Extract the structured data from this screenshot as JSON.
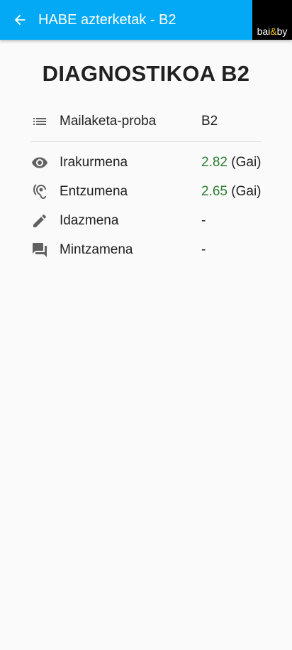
{
  "appbar": {
    "title": "HABE azterketak - B2",
    "back_icon": "arrow-back-icon",
    "logo": {
      "left": "bai",
      "amp": "&",
      "right": "by",
      "amp_color": "#f5c400"
    },
    "background": "#03a9f4"
  },
  "page": {
    "title": "DIAGNOSTIKOA B2"
  },
  "summary": {
    "icon": "list-icon",
    "label": "Mailaketa-proba",
    "value": "B2"
  },
  "skills": [
    {
      "icon": "eye-icon",
      "label": "Irakurmena",
      "score": "2.82",
      "result": "(Gai)"
    },
    {
      "icon": "hearing-icon",
      "label": "Entzumena",
      "score": "2.65",
      "result": "(Gai)"
    },
    {
      "icon": "pencil-icon",
      "label": "Idazmena",
      "value": "-"
    },
    {
      "icon": "chat-icon",
      "label": "Mintzamena",
      "value": "-"
    }
  ],
  "colors": {
    "score": "#2e7d32",
    "icon": "#616161"
  }
}
